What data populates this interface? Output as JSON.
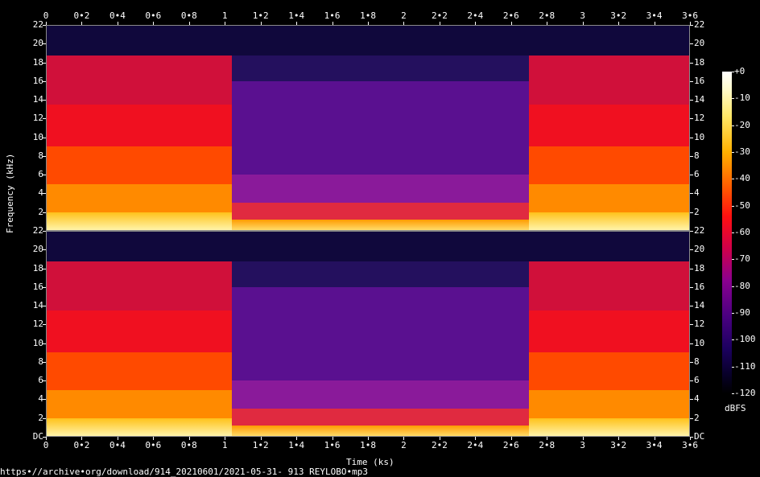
{
  "chart_data": {
    "type": "heatmap",
    "title": "",
    "xlabel": "Time (ks)",
    "ylabel": "Frequency (kHz)",
    "xlim": [
      0,
      3.6
    ],
    "ylim": [
      0,
      22
    ],
    "x_ticks": [
      "0",
      "0•2",
      "0•4",
      "0•6",
      "0•8",
      "1",
      "1•2",
      "1•4",
      "1•6",
      "1•8",
      "2",
      "2•2",
      "2•4",
      "2•6",
      "2•8",
      "3",
      "3•2",
      "3•4",
      "3•6"
    ],
    "y_ticks_top": [
      "22",
      "20",
      "18",
      "16",
      "14",
      "12",
      "10",
      "8",
      "6",
      "4",
      "2"
    ],
    "y_ticks_bottom": [
      "22",
      "20",
      "18",
      "16",
      "14",
      "12",
      "10",
      "8",
      "6",
      "4",
      "2",
      "DC"
    ],
    "channels": 2,
    "colorbar": {
      "label": "dBFS",
      "ticks": [
        "+0",
        "-10",
        "-20",
        "-30",
        "-40",
        "-50",
        "-60",
        "-70",
        "-80",
        "-90",
        "-100",
        "-110",
        "-120"
      ],
      "range": [
        -120,
        0
      ]
    },
    "segments": [
      {
        "start": 0.0,
        "end": 0.75,
        "cutoff_khz": 18.7,
        "level": "loud"
      },
      {
        "start": 0.75,
        "end": 1.04,
        "cutoff_khz": 18.7,
        "level": "loud"
      },
      {
        "start": 1.04,
        "end": 2.7,
        "cutoff_khz": 16.0,
        "level": "quiet"
      },
      {
        "start": 2.7,
        "end": 3.6,
        "cutoff_khz": 18.7,
        "level": "loud"
      }
    ]
  },
  "footer": {
    "url": "https•//archive•org/download/914_20210601/2021-05-31- 913 REYLOBO•mp3"
  }
}
